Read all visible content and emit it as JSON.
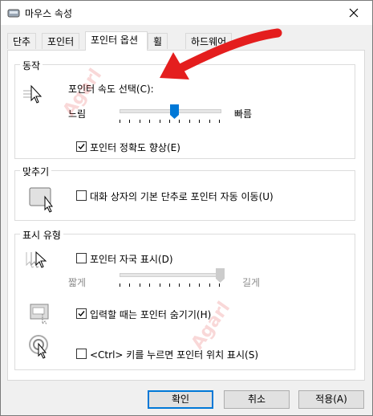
{
  "window": {
    "title": "마우스 속성"
  },
  "tabs": [
    {
      "label": "단추"
    },
    {
      "label": "포인터"
    },
    {
      "label": "포인터 옵션"
    },
    {
      "label": "휠"
    },
    {
      "label": "하드웨어"
    }
  ],
  "motion": {
    "legend": "동작",
    "speed_label": "포인터 속도 선택(C):",
    "slow": "느림",
    "fast": "빠름",
    "speed_value": 0.55,
    "precision_label": "포인터 정확도 향상(E)",
    "precision_checked": true
  },
  "snap": {
    "legend": "맞추기",
    "label": "대화 상자의 기본 단추로 포인터 자동 이동(U)",
    "checked": false
  },
  "visibility": {
    "legend": "표시 유형",
    "trails_label": "포인터 자국 표시(D)",
    "trails_checked": false,
    "short": "짧게",
    "long": "길게",
    "trails_value": 1.0,
    "hide_label": "입력할 때는 포인터 숨기기(H)",
    "hide_checked": true,
    "ctrl_label": "<Ctrl> 키를 누르면 포인터 위치 표시(S)",
    "ctrl_checked": false
  },
  "buttons": {
    "ok": "확인",
    "cancel": "취소",
    "apply": "적용(A)"
  },
  "colors": {
    "accent": "#0078d7",
    "annotation": "#e41e1e"
  }
}
